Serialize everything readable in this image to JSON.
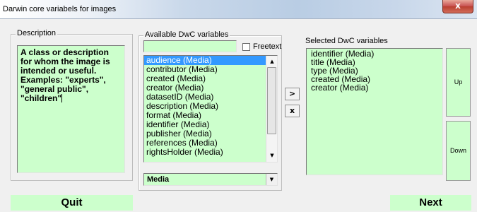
{
  "window": {
    "title": "Darwin core variabels for images",
    "close_label": "x"
  },
  "description": {
    "label": "Description",
    "text": "A class or description for whom the image is intended or useful. Examples: \"experts\", \"general public\", \"children\""
  },
  "available": {
    "label": "Available DwC variables",
    "freetext_value": "",
    "freetext_label": "Freetext",
    "freetext_checked": false,
    "items": [
      "audience (Media)",
      "contributor (Media)",
      "created (Media)",
      "creator (Media)",
      "datasetID (Media)",
      "description (Media)",
      "format (Media)",
      "identifier (Media)",
      "publisher (Media)",
      "references (Media)",
      "rightsHolder (Media)"
    ],
    "selected_index": 0,
    "category_value": "Media"
  },
  "transfer": {
    "add_label": ">",
    "remove_label": "x"
  },
  "selected": {
    "label": "Selected DwC variables",
    "items": [
      "identifier (Media)",
      "title (Media)",
      "type (Media)",
      "created (Media)",
      "creator (Media)"
    ],
    "up_label": "Up",
    "down_label": "Down"
  },
  "footer": {
    "quit_label": "Quit",
    "next_label": "Next"
  },
  "colors": {
    "field_green": "#ccffcc",
    "selection_blue": "#3399ff"
  }
}
